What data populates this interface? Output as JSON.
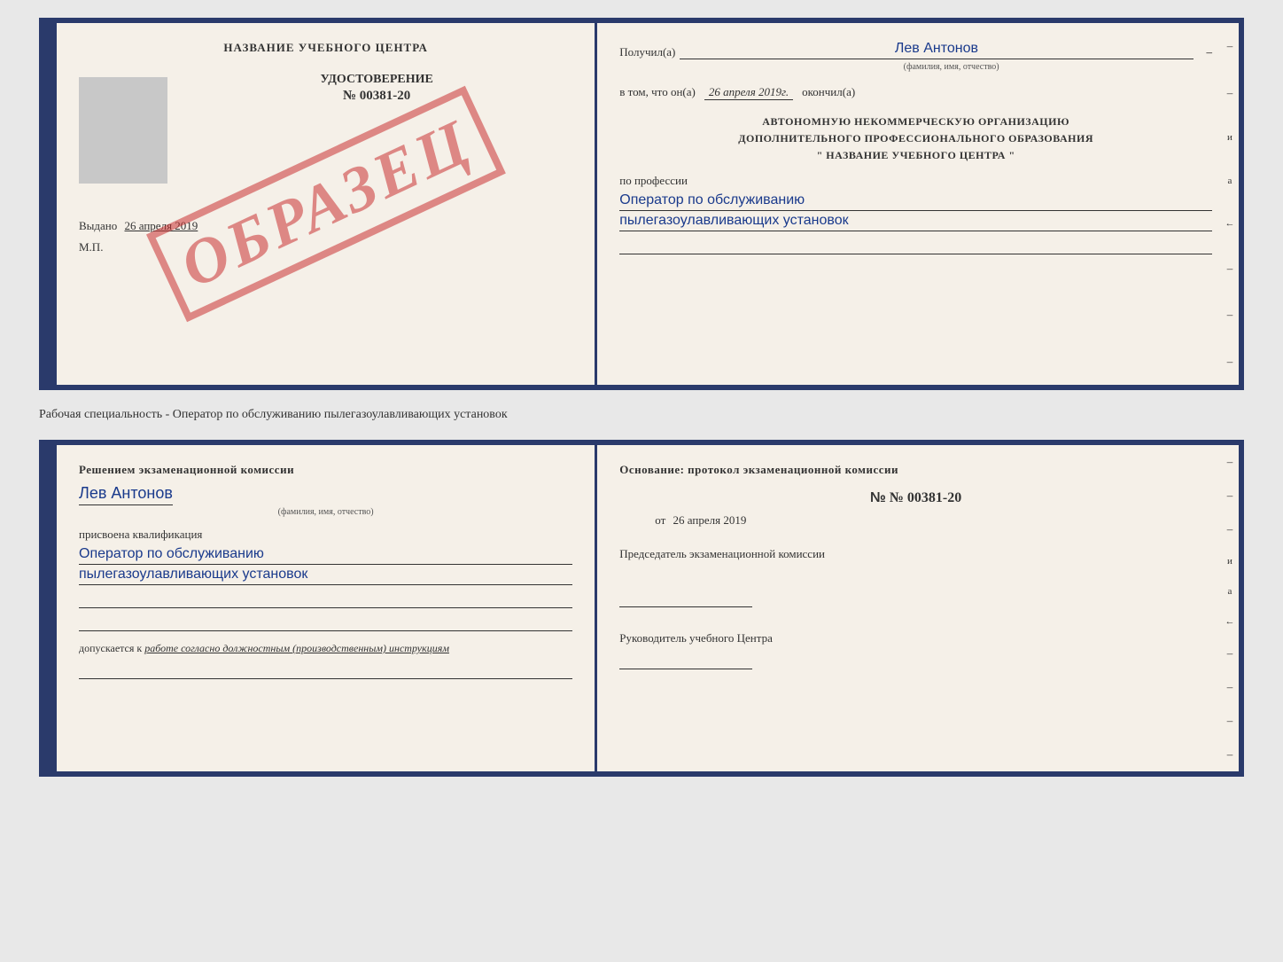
{
  "top_book": {
    "left_page": {
      "school_name": "НАЗВАНИЕ УЧЕБНОГО ЦЕНТРА",
      "udostoverenie": "УДОСТОВЕРЕНИЕ",
      "doc_number": "№ 00381-20",
      "vydano_label": "Выдано",
      "vydano_date": "26 апреля 2019",
      "mp_label": "М.П.",
      "stamp_text": "ОБРАЗЕЦ"
    },
    "right_page": {
      "poluchil_label": "Получил(а)",
      "poluchil_name": "Лев Антонов",
      "fio_caption": "(фамилия, имя, отчество)",
      "vtom_label": "в том, что он(а)",
      "vtom_date": "26 апреля 2019г.",
      "okonchil_label": "окончил(а)",
      "org_line1": "АВТОНОМНУЮ НЕКОММЕРЧЕСКУЮ ОРГАНИЗАЦИЮ",
      "org_line2": "ДОПОЛНИТЕЛЬНОГО ПРОФЕССИОНАЛЬНОГО ОБРАЗОВАНИЯ",
      "org_line3": "\"   НАЗВАНИЕ УЧЕБНОГО ЦЕНТРА   \"",
      "po_professii": "по профессии",
      "profession1": "Оператор по обслуживанию",
      "profession2": "пылегазоулавливающих установок"
    }
  },
  "separator": {
    "text": "Рабочая специальность - Оператор по обслуживанию пылегазоулавливающих установок"
  },
  "bottom_book": {
    "left_page": {
      "resheniem_title": "Решением экзаменационной комиссии",
      "person_name": "Лев Антонов",
      "fio_caption": "(фамилия, имя, отчество)",
      "prisvoena_label": "присвоена квалификация",
      "qualification1": "Оператор по обслуживанию",
      "qualification2": "пылегазоулавливающих установок",
      "dopuskaetsya_label": "допускается к",
      "dopuskaetsya_value": "работе согласно должностным (производственным) инструкциям"
    },
    "right_page": {
      "osnovanie_label": "Основание: протокол экзаменационной комиссии",
      "protocol_number": "№  00381-20",
      "ot_label": "от",
      "ot_date": "26 апреля 2019",
      "predsedatel_label": "Председатель экзаменационной комиссии",
      "rukovoditel_label": "Руководитель учебного Центра"
    }
  },
  "side_marks": {
    "marks": [
      "–",
      "–",
      "–",
      "и",
      "а",
      "←",
      "–",
      "–",
      "–",
      "–"
    ]
  }
}
